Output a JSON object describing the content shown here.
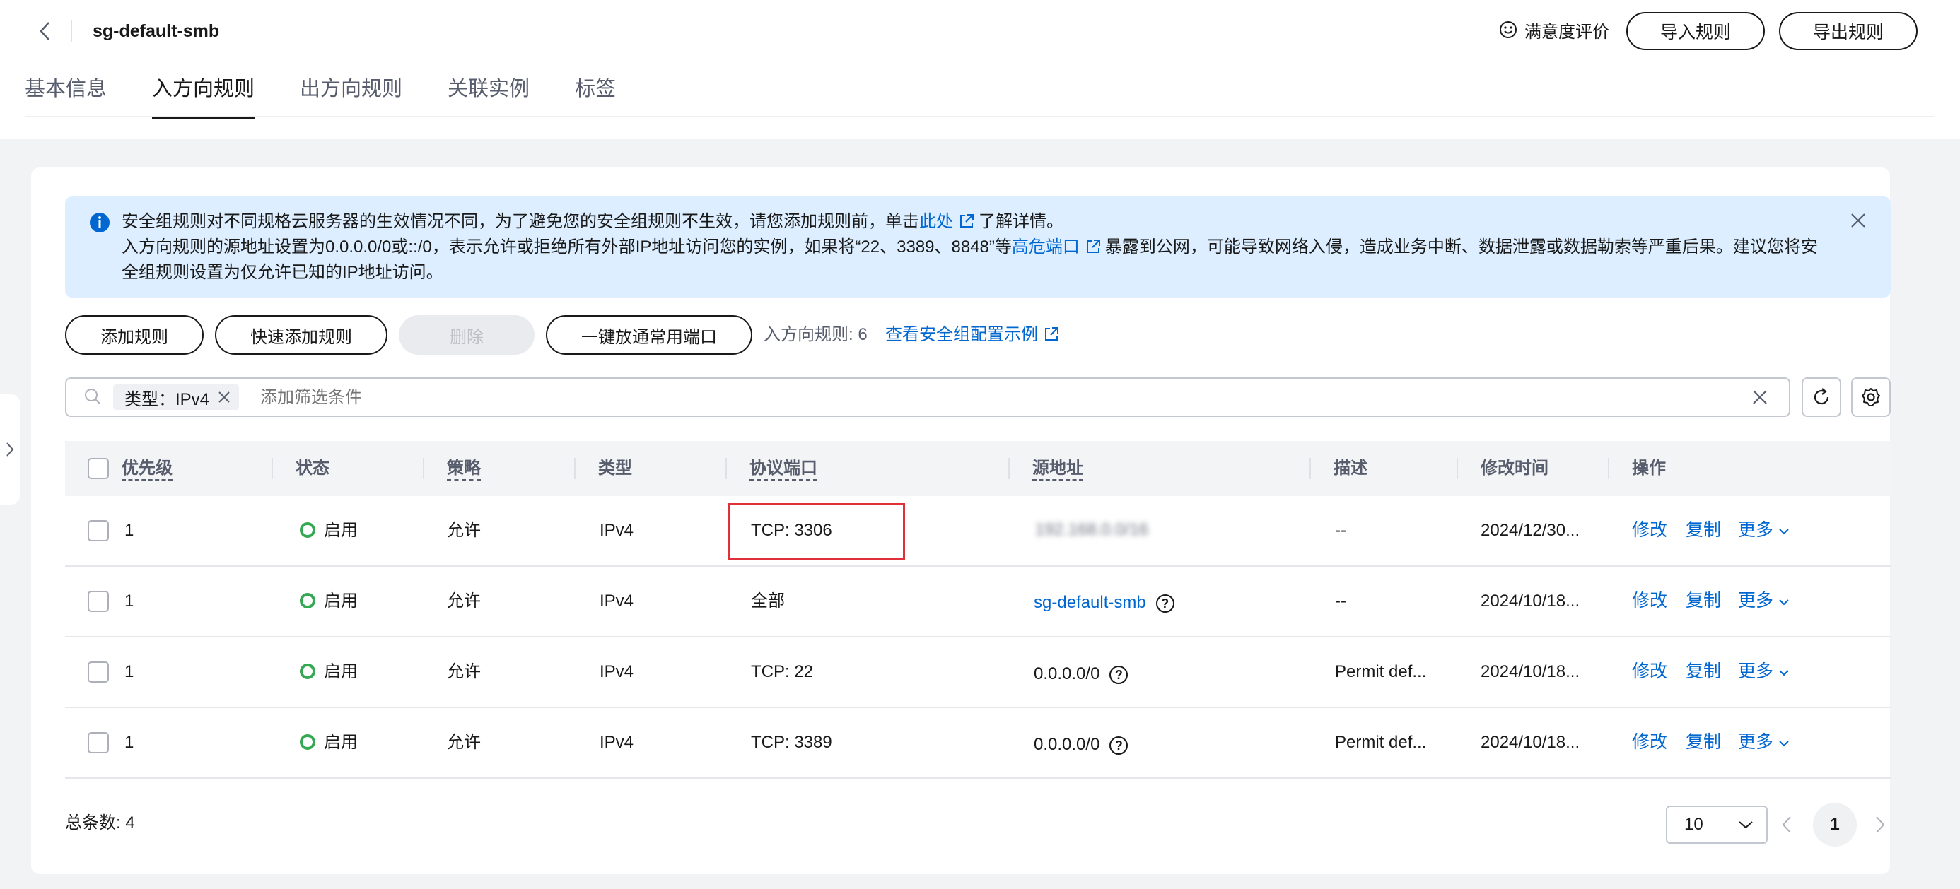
{
  "header": {
    "title": "sg-default-smb",
    "satisfaction_label": "满意度评价",
    "import_label": "导入规则",
    "export_label": "导出规则"
  },
  "tabs": [
    {
      "label": "基本信息",
      "active": false
    },
    {
      "label": "入方向规则",
      "active": true
    },
    {
      "label": "出方向规则",
      "active": false
    },
    {
      "label": "关联实例",
      "active": false
    },
    {
      "label": "标签",
      "active": false
    }
  ],
  "notice": {
    "line1_prefix": "安全组规则对不同规格云服务器的生效情况不同，为了避免您的安全组规则不生效，请您添加规则前，单击",
    "line1_link": "此处",
    "line1_suffix": "了解详情。",
    "line2_prefix": "入方向规则的源地址设置为0.0.0.0/0或::/0，表示允许或拒绝所有外部IP地址访问您的实例，如果将“22、3389、8848”等",
    "line2_link": "高危端口",
    "line2_suffix": "暴露到公网，可能导致网络入侵，造成业务中断、数据泄露或数据勒索等严重后果。建议您将安全组规则设置为仅允许已知的IP地址访问。"
  },
  "toolbar": {
    "add_rule": "添加规则",
    "quick_add": "快速添加规则",
    "delete": "删除",
    "open_ports": "一键放通常用端口",
    "rule_count": "入方向规则: 6",
    "example_link": "查看安全组配置示例"
  },
  "search": {
    "chip_label": "类型：IPv4",
    "placeholder": "添加筛选条件"
  },
  "table": {
    "headers": {
      "priority": "优先级",
      "status": "状态",
      "policy": "策略",
      "type": "类型",
      "port": "协议端口",
      "source": "源地址",
      "desc": "描述",
      "modified": "修改时间",
      "actions": "操作"
    },
    "rows": [
      {
        "priority": "1",
        "status": "启用",
        "policy": "允许",
        "type": "IPv4",
        "port": "TCP: 3306",
        "source": "192.168.0.0/16",
        "source_blurred": true,
        "source_link": false,
        "help": false,
        "desc": "--",
        "modified": "2024/12/30...",
        "edit": "修改",
        "copy": "复制",
        "more": "更多"
      },
      {
        "priority": "1",
        "status": "启用",
        "policy": "允许",
        "type": "IPv4",
        "port": "全部",
        "source": "sg-default-smb",
        "source_blurred": false,
        "source_link": true,
        "help": true,
        "desc": "--",
        "modified": "2024/10/18...",
        "edit": "修改",
        "copy": "复制",
        "more": "更多"
      },
      {
        "priority": "1",
        "status": "启用",
        "policy": "允许",
        "type": "IPv4",
        "port": "TCP: 22",
        "source": "0.0.0.0/0",
        "source_blurred": false,
        "source_link": false,
        "help": true,
        "desc": "Permit def...",
        "modified": "2024/10/18...",
        "edit": "修改",
        "copy": "复制",
        "more": "更多"
      },
      {
        "priority": "1",
        "status": "启用",
        "policy": "允许",
        "type": "IPv4",
        "port": "TCP: 3389",
        "source": "0.0.0.0/0",
        "source_blurred": false,
        "source_link": false,
        "help": true,
        "desc": "Permit def...",
        "modified": "2024/10/18...",
        "edit": "修改",
        "copy": "复制",
        "more": "更多"
      }
    ]
  },
  "footer": {
    "total": "总条数: 4",
    "page_size": "10",
    "current_page": "1"
  },
  "colors": {
    "accent": "#0067d1",
    "status_enabled": "#34a853",
    "highlight": "#e0303a",
    "notice_bg": "#dceeff"
  }
}
